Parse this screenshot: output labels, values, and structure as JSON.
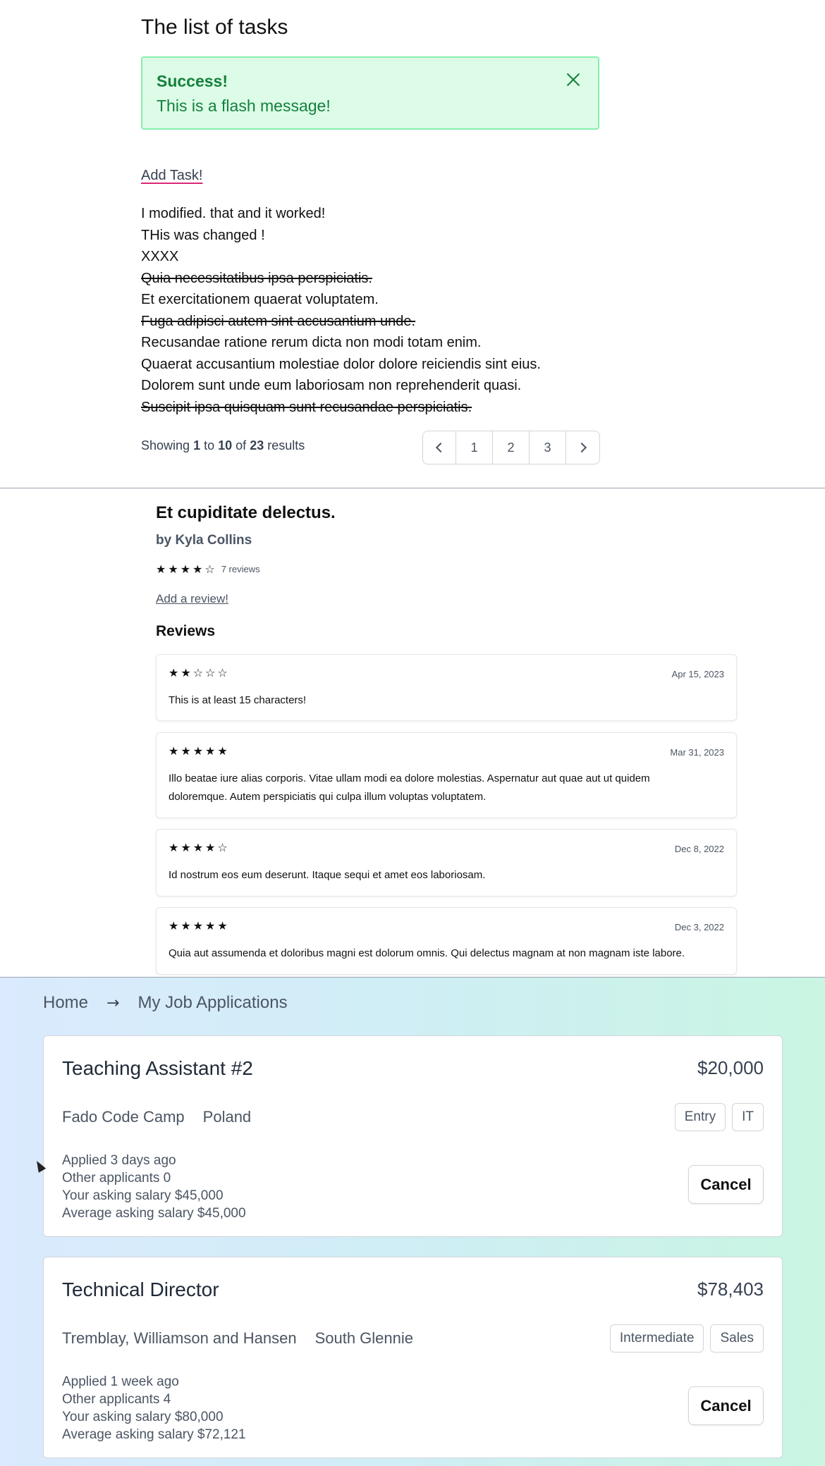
{
  "tasks": {
    "title": "The list of tasks",
    "flash": {
      "title": "Success!",
      "message": "This is a flash message!"
    },
    "add_task_label": "Add Task!",
    "items": [
      {
        "text": "I modified. that and it worked!",
        "done": false
      },
      {
        "text": "THis was changed !",
        "done": false
      },
      {
        "text": "XXXX",
        "done": false
      },
      {
        "text": "Quia necessitatibus ipsa perspiciatis.",
        "done": true
      },
      {
        "text": "Et exercitationem quaerat voluptatem.",
        "done": false
      },
      {
        "text": "Fuga adipisci autem sint accusantium unde.",
        "done": true
      },
      {
        "text": "Recusandae ratione rerum dicta non modi totam enim.",
        "done": false
      },
      {
        "text": "Quaerat accusantium molestiae dolor dolore reiciendis sint eius.",
        "done": false
      },
      {
        "text": "Dolorem sunt unde eum laboriosam non reprehenderit quasi.",
        "done": false
      },
      {
        "text": "Suscipit ipsa quisquam sunt recusandae perspiciatis.",
        "done": true
      }
    ],
    "pagination": {
      "showing_prefix": "Showing",
      "from": "1",
      "to_word": "to",
      "to": "10",
      "of_word": "of",
      "total": "23",
      "results_word": "results",
      "pages": [
        "1",
        "2",
        "3"
      ]
    }
  },
  "book": {
    "title": "Et cupiditate delectus.",
    "author": "by Kyla Collins",
    "rating_stars": "★★★★☆",
    "rating_value": 4,
    "review_count": "7 reviews",
    "add_review_label": "Add a review!",
    "reviews_heading": "Reviews",
    "reviews": [
      {
        "stars": "★★☆☆☆",
        "rating": 2,
        "date": "Apr 15, 2023",
        "text": "This is at least 15 characters!"
      },
      {
        "stars": "★★★★★",
        "rating": 5,
        "date": "Mar 31, 2023",
        "text": "Illo beatae iure alias corporis. Vitae ullam modi ea dolore molestias. Aspernatur aut quae aut ut quidem doloremque. Autem perspiciatis qui culpa illum voluptas voluptatem."
      },
      {
        "stars": "★★★★☆",
        "rating": 4,
        "date": "Dec 8, 2022",
        "text": "Id nostrum eos eum deserunt. Itaque sequi et amet eos laboriosam."
      },
      {
        "stars": "★★★★★",
        "rating": 5,
        "date": "Dec 3, 2022",
        "text": "Quia aut assumenda et doloribus magni est dolorum omnis. Qui delectus magnam at non magnam iste labore."
      }
    ]
  },
  "jobs": {
    "breadcrumb": {
      "home": "Home",
      "separator": "→",
      "current": "My Job Applications"
    },
    "cancel_label": "Cancel",
    "applications": [
      {
        "title": "Teaching Assistant #2",
        "salary": "$20,000",
        "company": "Fado Code Camp",
        "location": "Poland",
        "tags": [
          "Entry",
          "IT"
        ],
        "applied": "Applied 3 days ago",
        "other_applicants": "Other applicants 0",
        "your_salary": "Your asking salary $45,000",
        "average_salary": "Average asking salary $45,000"
      },
      {
        "title": "Technical Director",
        "salary": "$78,403",
        "company": "Tremblay, Williamson and Hansen",
        "location": "South Glennie",
        "tags": [
          "Intermediate",
          "Sales"
        ],
        "applied": "Applied 1 week ago",
        "other_applicants": "Other applicants 4",
        "your_salary": "Your asking salary $80,000",
        "average_salary": "Average asking salary $72,121"
      }
    ]
  },
  "icons": [
    "close-icon",
    "chevron-left-icon",
    "chevron-right-icon",
    "star-icon",
    "arrow-right-icon",
    "mouse-cursor-icon"
  ],
  "colors": {
    "flash_bg": "#dcfce7",
    "flash_text": "#15803d",
    "underline_accent": "#db2777"
  }
}
